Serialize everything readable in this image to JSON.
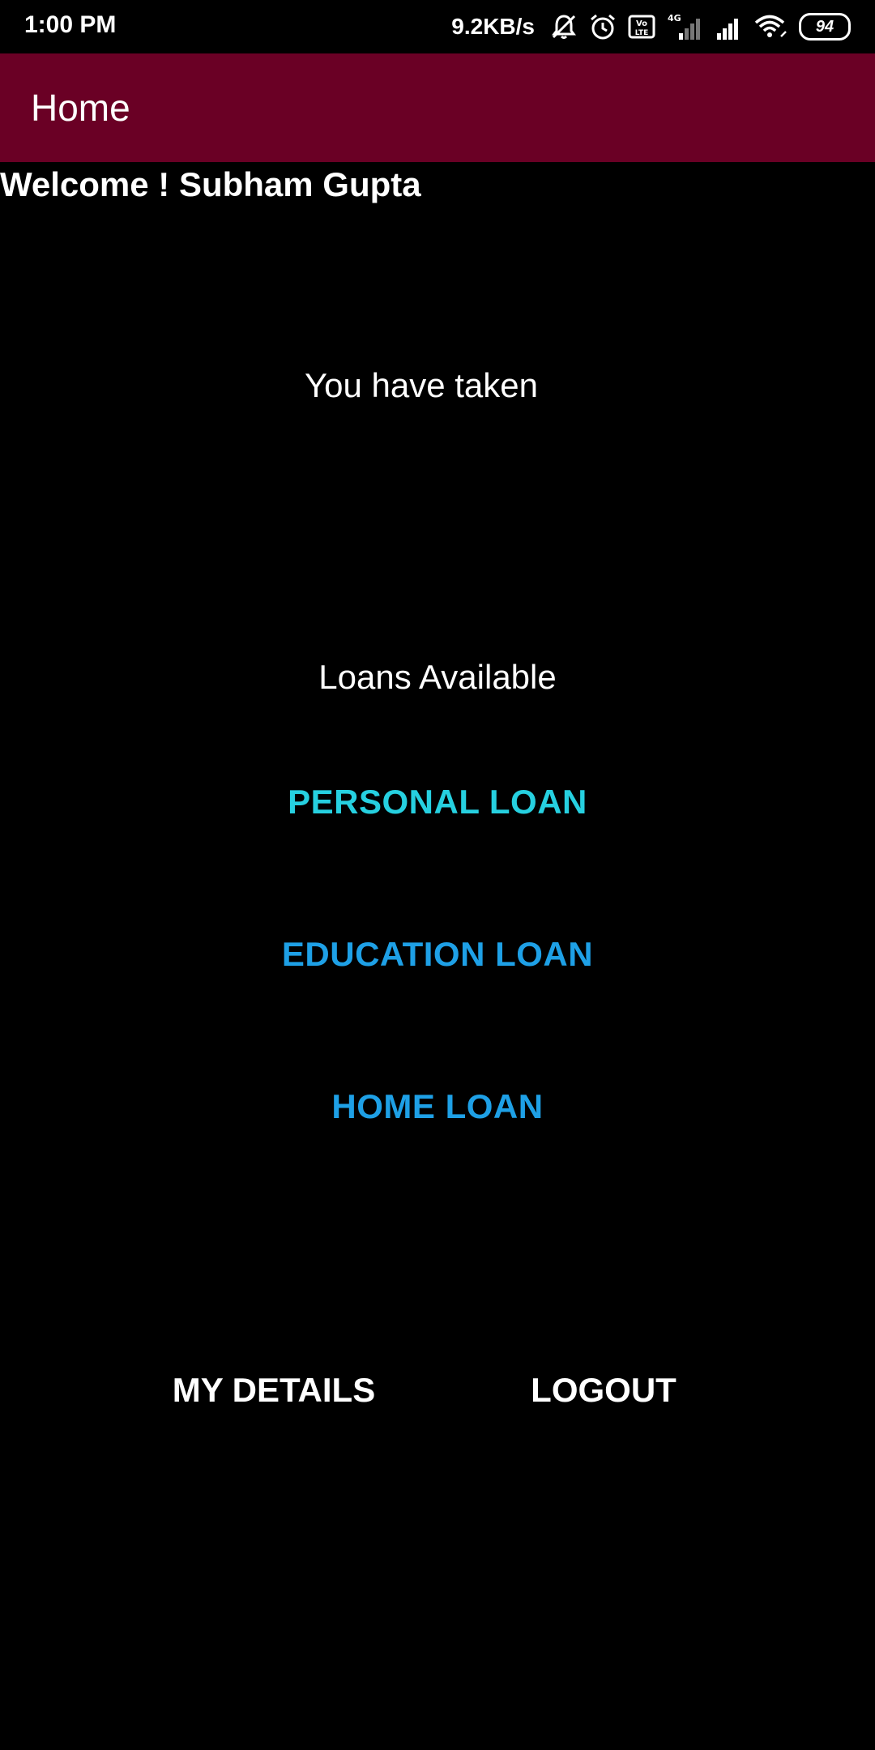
{
  "status_bar": {
    "time": "1:00 PM",
    "net_speed": "9.2KB/s",
    "network_type": "4G",
    "volte_label": "Vo LTE",
    "battery_level": "94",
    "icons": [
      "mute-icon",
      "alarm-icon",
      "volte-icon",
      "signal-icon",
      "signal-icon",
      "wifi-icon",
      "battery-icon"
    ]
  },
  "app_bar": {
    "title": "Home",
    "color": "#6a0025"
  },
  "welcome_text": "Welcome ! Subham Gupta",
  "taken_text": "You have taken",
  "loans_heading": "Loans Available",
  "loans": [
    {
      "label": "PERSONAL LOAN",
      "color": "#26d0e0"
    },
    {
      "label": "EDUCATION LOAN",
      "color": "#1ea0e6"
    },
    {
      "label": "HOME LOAN",
      "color": "#1ea0e6"
    }
  ],
  "actions": {
    "my_details_label": "MY DETAILS",
    "logout_label": "LOGOUT"
  }
}
